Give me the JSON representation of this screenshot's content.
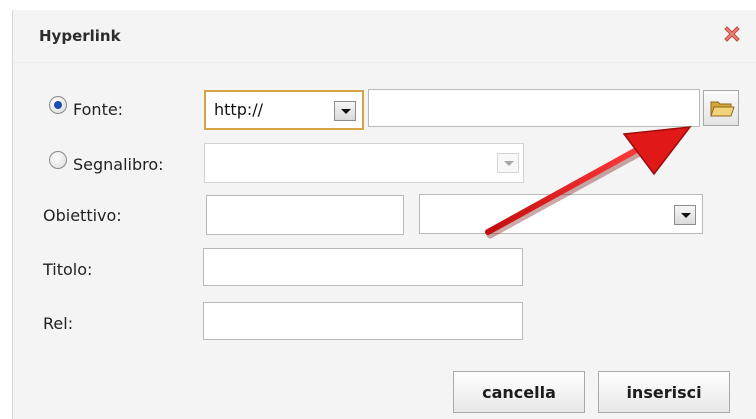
{
  "dialog": {
    "title": "Hyperlink",
    "close_icon": "close-x-icon"
  },
  "form": {
    "source": {
      "label": "Fonte:",
      "selected": true,
      "protocol_value": "http://",
      "url_value": ""
    },
    "bookmark": {
      "label": "Segnalibro:",
      "selected": false,
      "value": ""
    },
    "target": {
      "label": "Obiettivo:",
      "text_value": "",
      "select_value": ""
    },
    "title_field": {
      "label": "Titolo:",
      "value": ""
    },
    "rel_field": {
      "label": "Rel:",
      "value": ""
    }
  },
  "buttons": {
    "cancel_label": "cancella",
    "insert_label": "inserisci"
  },
  "annotation": {
    "arrow_color": "#e01818",
    "arrow_target": "browse-folder-button"
  },
  "colors": {
    "dialog_bg": "#f4f4f4",
    "protocol_highlight": "#d7a445",
    "folder_icon": "#e9c35a"
  }
}
